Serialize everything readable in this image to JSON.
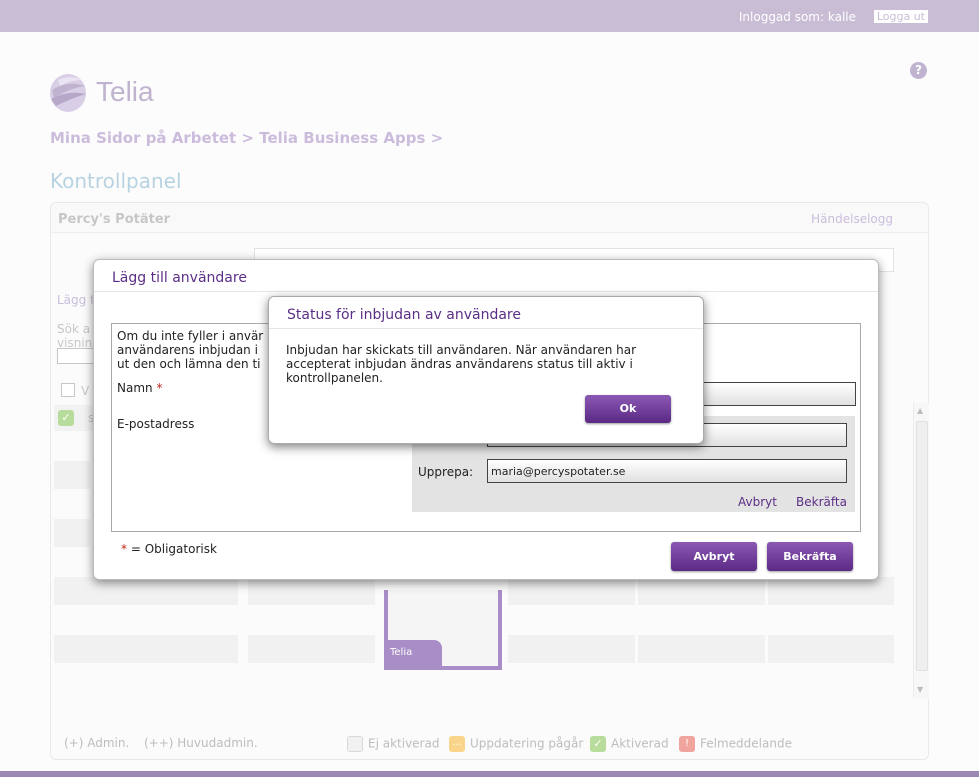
{
  "header": {
    "logged_in_label": "Inloggad som: kalle",
    "logout_label": "Logga ut"
  },
  "brand": {
    "logo_text": "Telia",
    "logo_icon": "telia-globe-icon",
    "color": "#9b88b3"
  },
  "help_icon": "?",
  "breadcrumb": "Mina Sidor på Arbetet > Telia Business Apps >",
  "page_title": "Kontrollpanel",
  "panel": {
    "company": "Percy's Potäter",
    "event_log": "Händelselogg",
    "partial_add_label": "Lägg t",
    "partial_search_label": "Sök a",
    "partial_search_label2": "visnin",
    "partial_select_label": "V",
    "partial_row_label": "s"
  },
  "legend": {
    "admin": "(+) Admin.",
    "head_admin": "(++) Huvudadmin.",
    "not_activated": "Ej aktiverad",
    "updating": "Uppdatering pågår",
    "activated": "Aktiverad",
    "error": "Felmeddelande"
  },
  "add_user_dialog": {
    "title": "Lägg till användare",
    "info_line1": "Om du inte fyller i anvär",
    "info_line2": "användarens inbjudan i",
    "info_line3": "ut den och lämna den ti",
    "name_label": "Namn",
    "required_marker": "*",
    "email_label": "E-postadress",
    "repeat_label": "Upprepa:",
    "repeat_value": "maria@percyspotater.se",
    "inline_cancel": "Avbryt",
    "inline_confirm": "Bekräfta",
    "required_note": "= Obligatorisk",
    "cancel_button": "Avbryt",
    "confirm_button": "Bekräfta"
  },
  "status_dialog": {
    "title": "Status för inbjudan av användare",
    "message": "Inbjudan har skickats till användaren. När användaren har accepterat inbjudan ändras användarens status till aktiv i kontrollpanelen.",
    "ok_button": "Ok"
  },
  "preview_label": "Telia"
}
